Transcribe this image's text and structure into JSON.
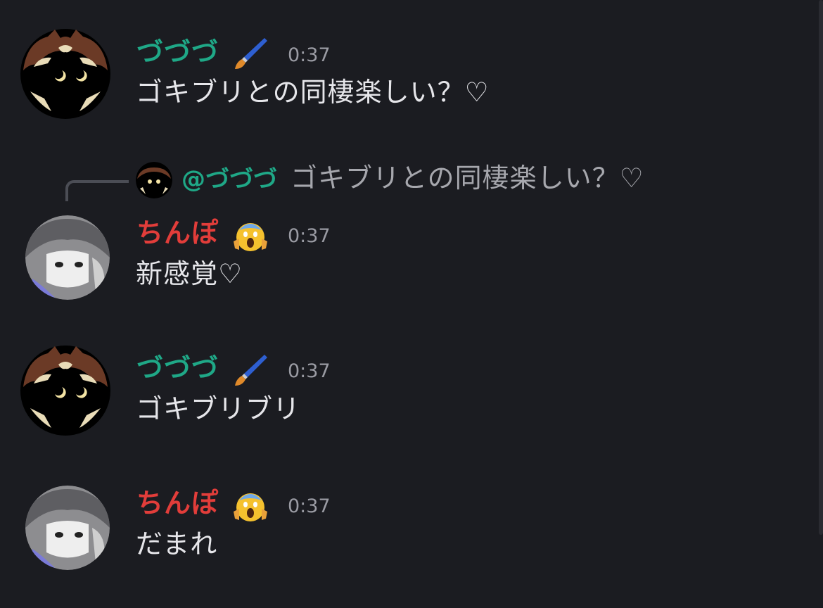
{
  "messages": [
    {
      "username": "づづづ",
      "badge_icon": "paintbrush-icon",
      "time": "0:37",
      "text": "ゴキブリとの同棲楽しい？♡"
    },
    {
      "reply": {
        "mention": "@づづづ",
        "text": "ゴキブリとの同棲楽しい？♡"
      },
      "username": "ちんぽ",
      "badge_icon": "screaming-face-icon",
      "time": "0:37",
      "text": "新感覚♡"
    },
    {
      "username": "づづづ",
      "badge_icon": "paintbrush-icon",
      "time": "0:37",
      "text": "ゴキブリブリ"
    },
    {
      "username": "ちんぽ",
      "badge_icon": "screaming-face-icon",
      "time": "0:37",
      "text": "だまれ"
    }
  ],
  "colors": {
    "background": "#1b1c21",
    "user_a": "#1fa887",
    "user_b": "#e23d3a",
    "timestamp": "#9a9ba3",
    "message_text": "#e6e6ea",
    "reply_text": "#a6a7ad"
  }
}
